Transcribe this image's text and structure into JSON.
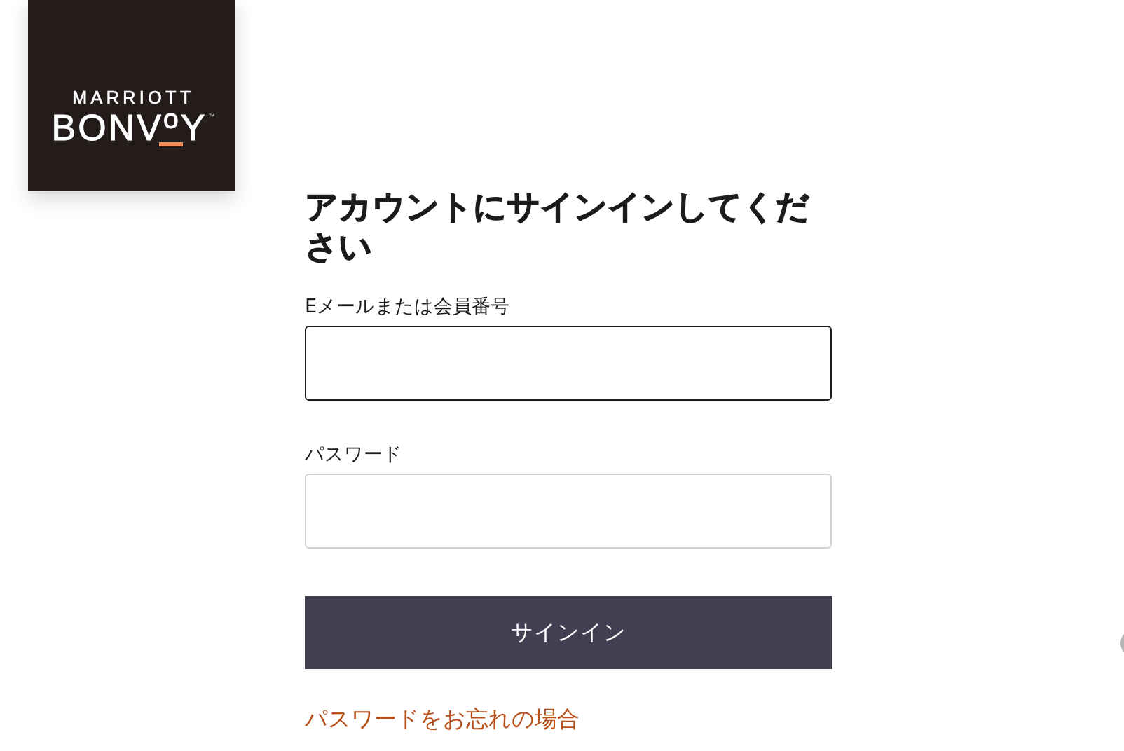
{
  "logo": {
    "brand": "MARRIOTT",
    "wordmark": "BONV$^{o}$Y",
    "trademark": "™"
  },
  "heading": "アカウントにサインインしてください",
  "fields": [
    {
      "label": "Eメールまたは会員番号",
      "focused": true
    },
    {
      "label": "パスワード",
      "focused": false
    }
  ],
  "sign_in_button": {
    "label": "サインイン"
  },
  "forgot_password_link": "パスワードをお忘れの場合"
}
